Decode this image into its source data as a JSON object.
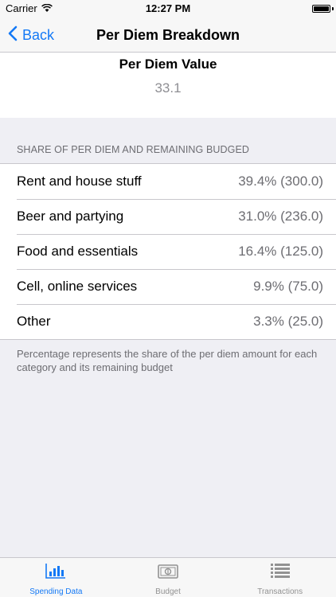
{
  "status_bar": {
    "carrier": "Carrier",
    "time": "12:27 PM",
    "wifi_icon": "wifi-icon",
    "battery_icon": "battery-icon"
  },
  "nav": {
    "back_label": "Back",
    "back_icon": "chevron-left-icon",
    "title": "Per Diem Breakdown"
  },
  "summary": {
    "title": "Per Diem Value",
    "value": "33.1"
  },
  "section": {
    "header": "SHARE OF PER DIEM AND REMAINING BUDGED",
    "rows": [
      {
        "label": "Rent and house stuff",
        "value": "39.4% (300.0)"
      },
      {
        "label": "Beer and partying",
        "value": "31.0% (236.0)"
      },
      {
        "label": "Food and essentials",
        "value": "16.4% (125.0)"
      },
      {
        "label": "Cell, online services",
        "value": "9.9% (75.0)"
      },
      {
        "label": "Other",
        "value": "3.3% (25.0)"
      }
    ],
    "footer": "Percentage represents the share of the per diem amount for each category and its remaining budget"
  },
  "tab_bar": {
    "tabs": [
      {
        "label": "Spending Data",
        "icon": "bar-chart-icon",
        "active": true
      },
      {
        "label": "Budget",
        "icon": "banknote-icon",
        "active": false
      },
      {
        "label": "Transactions",
        "icon": "list-icon",
        "active": false
      }
    ]
  },
  "colors": {
    "accent": "#1479f6",
    "background": "#efeff4",
    "secondary_text": "#6d6d72"
  }
}
